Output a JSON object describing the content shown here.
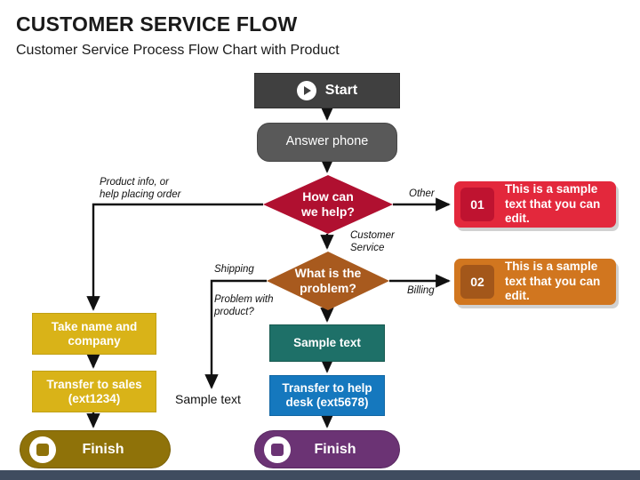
{
  "header": {
    "title": "CUSTOMER SERVICE FLOW",
    "subtitle": "Customer Service Process Flow Chart with Product"
  },
  "nodes": {
    "start": {
      "label": "Start",
      "icon": "play-icon",
      "color": "#404040"
    },
    "answer_phone": {
      "label": "Answer phone",
      "color": "#595959"
    },
    "decision_help": {
      "label": "How can\nwe help?",
      "color": "#b01030"
    },
    "decision_problem": {
      "label": "What is the\nproblem?",
      "color": "#a85a1e"
    },
    "take_name": {
      "label": "Take name and\ncompany",
      "color": "#d9b318"
    },
    "transfer_sales": {
      "label": "Transfer to sales\n(ext1234)",
      "color": "#d9b318"
    },
    "sample_text_box": {
      "label": "Sample text",
      "color": "#1e7068"
    },
    "transfer_helpdesk": {
      "label": "Transfer to help\ndesk (ext5678)",
      "color": "#1578be"
    },
    "finish_left": {
      "label": "Finish",
      "icon": "stop-icon",
      "color": "#8f7209"
    },
    "finish_right": {
      "label": "Finish",
      "icon": "stop-icon",
      "color": "#6b3374"
    }
  },
  "callouts": [
    {
      "number": "01",
      "text": "This is a sample text that you can edit.",
      "color": "#e3283c",
      "tab_color": "#bf1330"
    },
    {
      "number": "02",
      "text": "This is a sample text that you can edit.",
      "color": "#d1761f",
      "tab_color": "#a3571a"
    }
  ],
  "edge_labels": {
    "product_info": "Product info, or\nhelp placing order",
    "other": "Other",
    "customer_service": "Customer\nService",
    "shipping": "Shipping",
    "problem_with_product": "Problem with\nproduct?",
    "billing": "Billing"
  },
  "free_text": {
    "sample_text": "Sample text"
  },
  "footer": {
    "color": "#3f4c5f"
  }
}
